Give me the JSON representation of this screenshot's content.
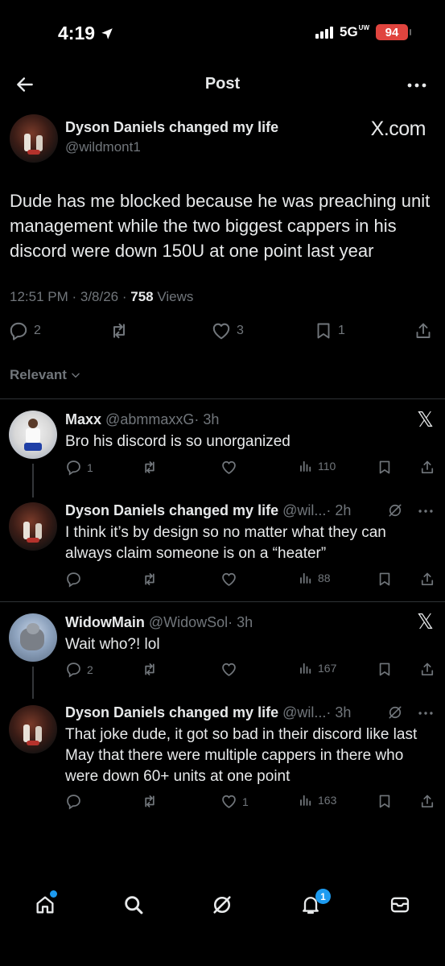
{
  "status_bar": {
    "time": "4:19",
    "network": "5G",
    "network_sup": "UW",
    "battery": "94"
  },
  "header": {
    "title": "Post"
  },
  "post": {
    "author_name": "Dyson Daniels changed my life",
    "author_handle": "@wildmont1",
    "source_label": "X.com",
    "text": "Dude has me blocked because he was preaching unit management while the two biggest cappers in his discord were down 150U at one point last year",
    "time": "12:51 PM · 3/8/26 · ",
    "views_count": "758",
    "views_label": " Views",
    "replies": "2",
    "reposts": "",
    "likes": "3",
    "bookmarks": "1"
  },
  "sort": {
    "label": "Relevant"
  },
  "replies": [
    {
      "name": "Maxx",
      "handle": "@abmmaxxG",
      "time": "· 3h",
      "text": "Bro his discord is so unorganized",
      "replies": "1",
      "reposts": "",
      "likes": "",
      "views": "110"
    },
    {
      "name": "Dyson Daniels changed my life",
      "handle": "@wil...",
      "time": "· 2h",
      "text": "I think it’s by design so no matter what they can always claim someone is on a “heater”",
      "replies": "",
      "reposts": "",
      "likes": "",
      "views": "88"
    },
    {
      "name": "WidowMain",
      "handle": "@WidowSol",
      "time": "· 3h",
      "text": "Wait who?! lol",
      "replies": "2",
      "reposts": "",
      "likes": "",
      "views": "167"
    },
    {
      "name": "Dyson Daniels changed my life",
      "handle": "@wil...",
      "time": "· 3h",
      "text": "That joke dude, it got so bad in their discord like last May that there were multiple cappers in there who were down 60+ units at one point",
      "replies": "",
      "reposts": "",
      "likes": "1",
      "views": "163"
    }
  ],
  "tabbar": {
    "notifications_badge": "1"
  },
  "colors": {
    "background": "#000000",
    "text": "#e7e9ea",
    "muted": "#71767b",
    "accent": "#1d9bf0",
    "divider": "#2f3336"
  },
  "icons": [
    "back-arrow-icon",
    "more-icon",
    "reply-icon",
    "repost-icon",
    "like-icon",
    "bookmark-icon",
    "share-icon",
    "views-icon",
    "grok-icon",
    "x-logo-icon",
    "home-icon",
    "search-icon",
    "notifications-icon",
    "messages-icon"
  ]
}
